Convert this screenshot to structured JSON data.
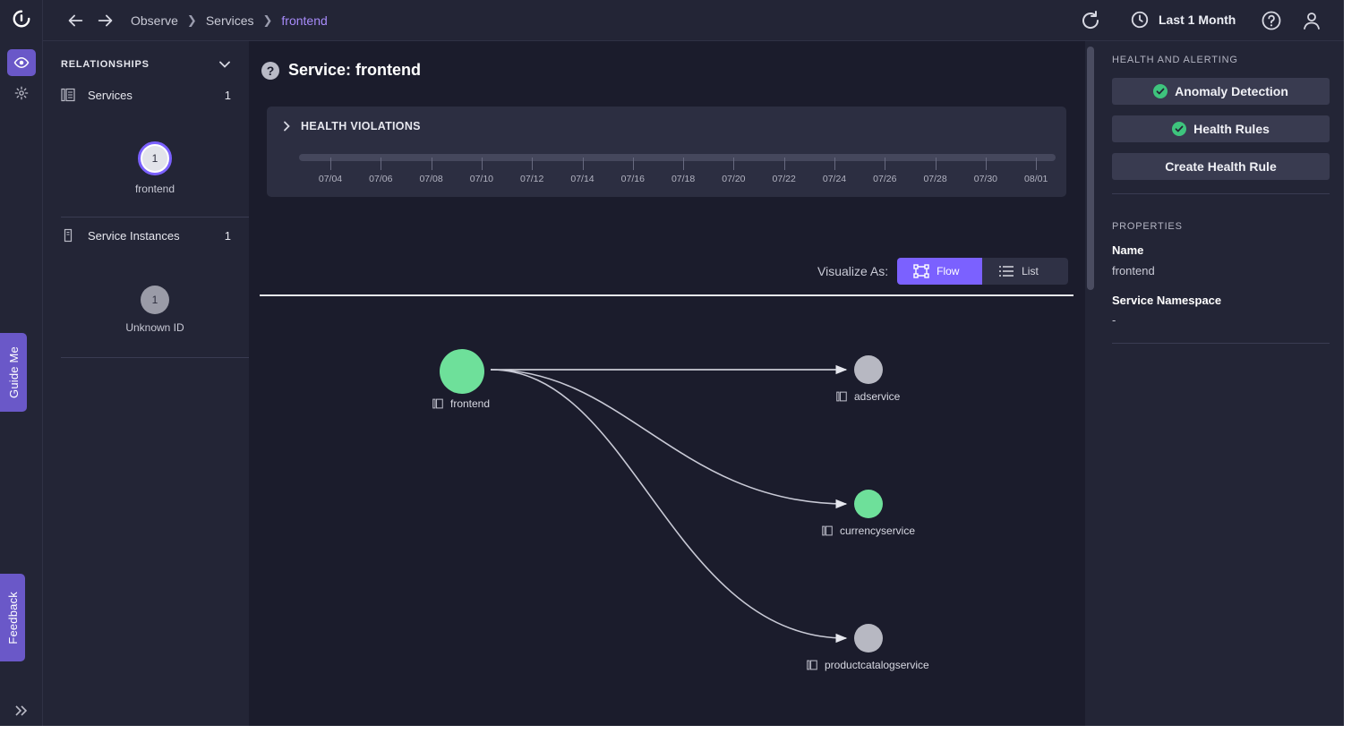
{
  "colors": {
    "accent": "#7b61ff",
    "healthy": "#6ee09a",
    "unknown": "#b7b8c2",
    "check": "#3ec47d"
  },
  "topbar": {
    "breadcrumb": [
      "Observe",
      "Services",
      "frontend"
    ],
    "time_range": "Last 1 Month",
    "icons": [
      "back-arrow-icon",
      "forward-arrow-icon",
      "refresh-icon",
      "clock-icon",
      "help-icon",
      "user-icon"
    ]
  },
  "rail": {
    "guide_me": "Guide Me",
    "feedback": "Feedback"
  },
  "relationships": {
    "title": "RELATIONSHIPS",
    "services": {
      "label": "Services",
      "count": "1",
      "node_count": "1",
      "node_label": "frontend"
    },
    "instances": {
      "label": "Service Instances",
      "count": "1",
      "node_count": "1",
      "node_label": "Unknown ID"
    }
  },
  "main": {
    "title": "Service: frontend",
    "health_violations": {
      "title": "HEALTH VIOLATIONS",
      "ticks": [
        "07/04",
        "07/06",
        "07/08",
        "07/10",
        "07/12",
        "07/14",
        "07/16",
        "07/18",
        "07/20",
        "07/22",
        "07/24",
        "07/26",
        "07/28",
        "07/30",
        "08/01"
      ]
    },
    "visualize": {
      "label": "Visualize As:",
      "flow": "Flow",
      "list": "List",
      "selected": "Flow"
    },
    "flow": {
      "source": {
        "name": "frontend",
        "status": "healthy"
      },
      "targets": [
        {
          "name": "adservice",
          "status": "unknown"
        },
        {
          "name": "currencyservice",
          "status": "healthy"
        },
        {
          "name": "productcatalogservice",
          "status": "unknown"
        }
      ]
    }
  },
  "right": {
    "health_title": "HEALTH AND ALERTING",
    "anomaly": "Anomaly Detection",
    "health_rules": "Health Rules",
    "create_rule": "Create Health Rule",
    "properties_title": "PROPERTIES",
    "name_key": "Name",
    "name_value": "frontend",
    "ns_key": "Service Namespace",
    "ns_value": "-"
  }
}
